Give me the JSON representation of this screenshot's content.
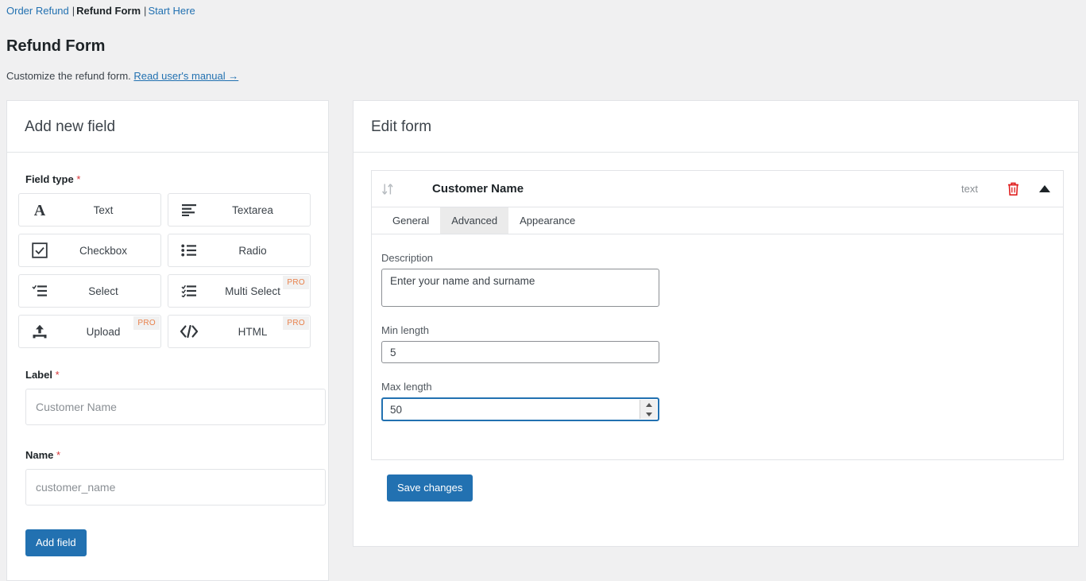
{
  "breadcrumb": {
    "items": [
      {
        "label": "Order Refund",
        "current": false
      },
      {
        "label": "Refund Form",
        "current": true
      },
      {
        "label": "Start Here",
        "current": false
      }
    ],
    "separator": "|"
  },
  "page": {
    "title": "Refund Form",
    "subtitle_text": "Customize the refund form.",
    "manual_link": "Read user's manual →"
  },
  "add_field_panel": {
    "title": "Add new field",
    "field_type_label": "Field type",
    "required_mark": "*",
    "field_types": [
      {
        "label": "Text",
        "icon": "letter-a-icon",
        "pro": null
      },
      {
        "label": "Textarea",
        "icon": "text-lines-icon",
        "pro": null
      },
      {
        "label": "Checkbox",
        "icon": "checkbox-icon",
        "pro": null
      },
      {
        "label": "Radio",
        "icon": "bullet-list-icon",
        "pro": null
      },
      {
        "label": "Select",
        "icon": "select-list-icon",
        "pro": null
      },
      {
        "label": "Multi Select",
        "icon": "multi-select-icon",
        "pro": "PRO"
      },
      {
        "label": "Upload",
        "icon": "upload-icon",
        "pro": "PRO"
      },
      {
        "label": "HTML",
        "icon": "code-icon",
        "pro": "PRO"
      }
    ],
    "label_field": {
      "label": "Label",
      "required_mark": "*",
      "value": "",
      "placeholder": "Customer Name"
    },
    "name_field": {
      "label": "Name",
      "required_mark": "*",
      "value": "",
      "placeholder": "customer_name"
    },
    "add_button": "Add field"
  },
  "edit_form_panel": {
    "title": "Edit form",
    "field": {
      "name": "Customer Name",
      "type_badge": "text",
      "drag_handle_icon": "drag-sort-icon",
      "delete_icon": "trash-icon",
      "collapse_icon": "caret-up-icon",
      "tabs": [
        {
          "label": "General",
          "active": false
        },
        {
          "label": "Advanced",
          "active": true
        },
        {
          "label": "Appearance",
          "active": false
        }
      ],
      "advanced": {
        "description_label": "Description",
        "description_value": "Enter your name and surname",
        "min_length_label": "Min length",
        "min_length_value": "5",
        "max_length_label": "Max length",
        "max_length_value": "50"
      }
    },
    "save_button": "Save changes"
  },
  "colors": {
    "link": "#2271b1",
    "primary_button": "#2271b1",
    "pro_badge_text": "#e8804a",
    "delete_icon": "#e02020",
    "page_background": "#f0f0f1"
  }
}
